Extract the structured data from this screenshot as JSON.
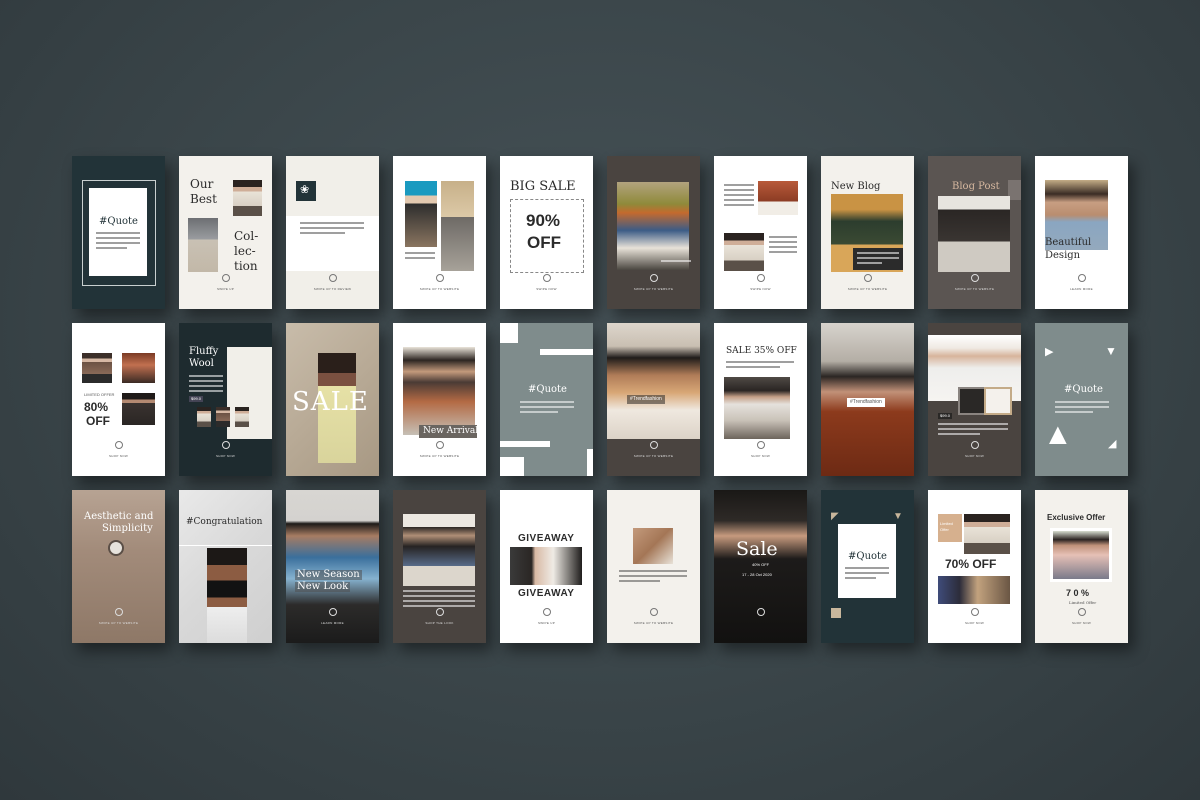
{
  "colors": {
    "background": "#3a4549",
    "dark_teal": "#223338",
    "charcoal": "#4a4440",
    "warm_gray": "#5b5552",
    "slate": "#7f8c8c",
    "cream": "#f3f1ec",
    "white": "#ffffff"
  },
  "icons": [
    "swipe-up-icon",
    "triangle-icon",
    "corner-bracket-icon"
  ],
  "cards": {
    "r1c1": {
      "title": "#Quote"
    },
    "r1c2": {
      "line1": "Our",
      "line2": "Best",
      "line3": "Col-",
      "line4": "lec-",
      "line5": "tion",
      "cta": "SWIPE UP"
    },
    "r1c3": {
      "cta": "SWIPE UP TO REVIEW"
    },
    "r1c4": {
      "cta": "SWIPE UP TO WEBSITE"
    },
    "r1c5": {
      "title": "BIG SALE",
      "pct": "90%",
      "off": "OFF",
      "cta": "SWIPE NOW"
    },
    "r1c6": {
      "cta": "SWIPE UP TO WEBSITE"
    },
    "r1c7": {
      "cta": "SWIPE NOW"
    },
    "r1c8": {
      "title": "New Blog",
      "cta": "SWIPE UP TO WEBSITE"
    },
    "r1c9": {
      "title": "Blog Post",
      "cta": "SWIPE UP TO WEBSITE"
    },
    "r1c10": {
      "line1": "Beautiful",
      "line2": "Design",
      "cta": "LEARN MORE"
    },
    "r2c1": {
      "label": "LIMITED OFFER",
      "pct": "80%",
      "off": "OFF",
      "cta": "SHOP NOW"
    },
    "r2c2": {
      "line1": "Fluffy",
      "line2": "Wool",
      "price": "$99.0",
      "cta": "SHOP NOW"
    },
    "r2c3": {
      "title": "SALE"
    },
    "r2c4": {
      "title": "New Arrival",
      "cta": "SWIPE UP TO WEBSITE"
    },
    "r2c5": {
      "title": "#Quote"
    },
    "r2c6": {
      "tag": "#Trendfashion",
      "cta": "SWIPE UP TO WEBSITE"
    },
    "r2c7": {
      "title": "SALE 35% OFF",
      "cta": "SHOP NOW"
    },
    "r2c8": {
      "tag": "#Trendfashion"
    },
    "r2c9": {
      "price": "$99.0",
      "cta": "SHOP NOW"
    },
    "r2c10": {
      "title": "#Quote"
    },
    "r3c1": {
      "line1": "Aesthetic and",
      "line2": "Simplicity",
      "cta": "SWIPE UP TO WEBSITE"
    },
    "r3c2": {
      "title": "#Congratulation"
    },
    "r3c3": {
      "line1": "New Season",
      "line2": "New Look",
      "cta": "LEARN MORE"
    },
    "r3c4": {
      "cta": "SHOP THE LOOK"
    },
    "r3c5": {
      "title1": "GIVEAWAY",
      "title2": "GIVEAWAY",
      "cta": "SWIPE UP"
    },
    "r3c6": {
      "cta": "SWIPE UP TO WEBSITE"
    },
    "r3c7": {
      "title": "Sale",
      "sub": "40% OFF",
      "dates": "17 - 28 Oct 2020"
    },
    "r3c8": {
      "title": "#Quote"
    },
    "r3c9": {
      "label1": "Limited",
      "label2": "Offer",
      "pct": "70% OFF",
      "cta": "SHOP NOW"
    },
    "r3c10": {
      "title": "Exclusive Offer",
      "pct": "7 0 %",
      "label": "Limited Offer",
      "cta": "SHOP NOW"
    }
  }
}
